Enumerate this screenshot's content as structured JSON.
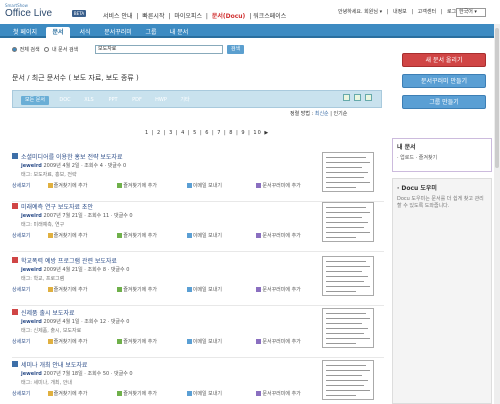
{
  "header": {
    "logo_small": "SmartShow",
    "logo": "Office Live",
    "badge": "BETA",
    "nav": [
      "서비스 안내",
      "|",
      "빠른시작",
      "|",
      "마이오피스",
      "|"
    ],
    "nav_active": "문서(Docu)",
    "nav_last": "| 워크스페이스",
    "account": [
      "안녕하세요. 회원님 ▾",
      "|",
      "내정보",
      "|",
      "고객센터",
      "|",
      "로그아웃"
    ],
    "language": "한국어 ▾"
  },
  "tabs": [
    "첫 페이지",
    "문서",
    "서식",
    "문서꾸러미",
    "그룹",
    "내 문서"
  ],
  "active_tab": 1,
  "search": {
    "radio_all": "전체 검색",
    "radio_mine": "내 문서 검색",
    "value": "보도자료",
    "button": "검색"
  },
  "section_title": "문서 / 최근 문서수 ( 보도 자료, 보도 종류 )",
  "filters": [
    "모든 문서",
    "DOC",
    "XLS",
    "PPT",
    "PDF",
    "HWP",
    "기타"
  ],
  "sort": {
    "label": "정렬 방법 :",
    "recent": "최신순",
    "sep": "|",
    "popular": "인기순"
  },
  "pager": "1 | 2 | 3 | 4 | 5 | 6 | 7 | 8 | 9 | 10 ▶",
  "documents": [
    {
      "title": "소셜미디어를 이용한 홍보 전략 보도자료",
      "user": "jeweird",
      "meta": "2009년 4월 2일 · 조회수 4 · 댓글수 0",
      "tag": "태그: 보도자료, 홍보, 전략",
      "icon_color": "#3d6fa8"
    },
    {
      "title": "미래예측 연구 보도자료 초안",
      "user": "jeweird",
      "meta": "2007년 7월 21일 · 조회수 11 · 댓글수 0",
      "tag": "태그: 미래예측, 연구",
      "icon_color": "#d04545"
    },
    {
      "title": "학교폭력 예방 프로그램 관련 보도자료",
      "user": "jeweird",
      "meta": "2009년 4월 21일 · 조회수 8 · 댓글수 0",
      "tag": "태그: 학교, 프로그램",
      "icon_color": "#d04545"
    },
    {
      "title": "신제품 출시 보도자료",
      "user": "jeweird",
      "meta": "2009년 4월 1일 · 조회수 12 · 댓글수 0",
      "tag": "태그: 신제품, 출시, 보도자료",
      "icon_color": "#d04545"
    },
    {
      "title": "세미나 개최 안내 보도자료",
      "user": "jeweird",
      "meta": "2007년 7월 18일 · 조회수 50 · 댓글수 0",
      "tag": "태그: 세미나, 개최, 안내",
      "icon_color": "#3d6fa8"
    }
  ],
  "actions": [
    "상세보기",
    "즐겨찾기에 추가",
    "즐겨찾기에 추가",
    "이메일 보내기",
    "문서꾸러미에 추가",
    "그룹에 추가"
  ],
  "sidebar": {
    "btn_upload": "새 문서 올리기",
    "btn_bundle": "문서꾸러미 만들기",
    "btn_group": "그룹 만들기",
    "mydocs_title": "내 문서",
    "mydocs_item": "· 업로드 · 즐겨찾기",
    "docu_title": "· Docu 도우미",
    "docu_desc": "Docu 도우미는 문서를 더 쉽게 찾고 관리할 수 있도록 도와줍니다."
  }
}
